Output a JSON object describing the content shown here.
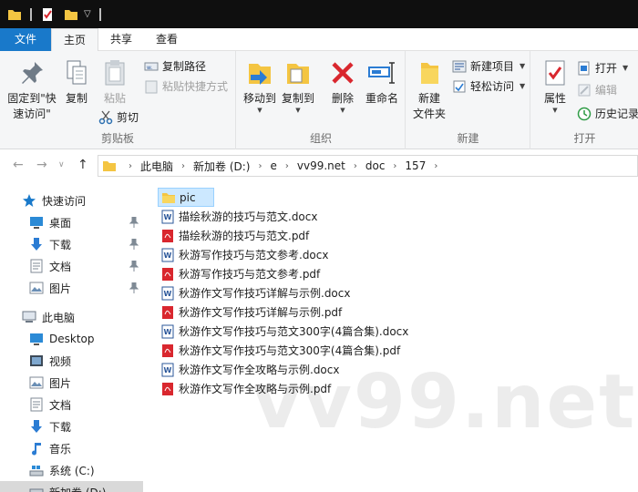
{
  "ribbon_tabs": [
    {
      "label": "文件"
    },
    {
      "label": "主页"
    },
    {
      "label": "共享"
    },
    {
      "label": "查看"
    }
  ],
  "clipboard": {
    "pin_label_1": "固定到\"快",
    "pin_label_2": "速访问\"",
    "copy": "复制",
    "paste": "粘贴",
    "copy_path": "复制路径",
    "paste_shortcut": "粘贴快捷方式",
    "cut": "剪切",
    "group": "剪贴板"
  },
  "organize": {
    "move_to": "移动到",
    "copy_to": "复制到",
    "delete": "删除",
    "rename": "重命名",
    "group": "组织"
  },
  "new_group": {
    "new_folder_1": "新建",
    "new_folder_2": "文件夹",
    "new_item": "新建项目",
    "easy_access": "轻松访问",
    "group": "新建"
  },
  "open_group": {
    "properties": "属性",
    "open": "打开",
    "edit": "编辑",
    "history": "历史记录",
    "group": "打开"
  },
  "address": {
    "crumbs": [
      "此电脑",
      "新加卷 (D:)",
      "e",
      "vv99.net",
      "doc",
      "157"
    ]
  },
  "nav": {
    "quick_access": "快速访问",
    "desktop": "桌面",
    "downloads": "下载",
    "documents": "文档",
    "pictures": "图片",
    "this_pc": "此电脑",
    "pc_desktop": "Desktop",
    "pc_videos": "视频",
    "pc_pictures": "图片",
    "pc_documents": "文档",
    "pc_downloads": "下载",
    "pc_music": "音乐",
    "drive_c": "系统 (C:)",
    "drive_d": "新加卷 (D:)"
  },
  "files": [
    {
      "name": "pic",
      "type": "folder"
    },
    {
      "name": "描绘秋游的技巧与范文.docx",
      "type": "docx"
    },
    {
      "name": "描绘秋游的技巧与范文.pdf",
      "type": "pdf"
    },
    {
      "name": "秋游写作技巧与范文参考.docx",
      "type": "docx"
    },
    {
      "name": "秋游写作技巧与范文参考.pdf",
      "type": "pdf"
    },
    {
      "name": "秋游作文写作技巧详解与示例.docx",
      "type": "docx"
    },
    {
      "name": "秋游作文写作技巧详解与示例.pdf",
      "type": "pdf"
    },
    {
      "name": "秋游作文写作技巧与范文300字(4篇合集).docx",
      "type": "docx"
    },
    {
      "name": "秋游作文写作技巧与范文300字(4篇合集).pdf",
      "type": "pdf"
    },
    {
      "name": "秋游作文写作全攻略与示例.docx",
      "type": "docx"
    },
    {
      "name": "秋游作文写作全攻略与示例.pdf",
      "type": "pdf"
    }
  ],
  "watermark": "vv99.net",
  "icons": {
    "folder": "folder-icon",
    "docx": "word-doc-icon",
    "pdf": "pdf-icon",
    "pin": "pin-icon",
    "star": "star-icon"
  },
  "colors": {
    "file_tab": "#1979ca",
    "folder": "#f4c542",
    "word": "#2b579a",
    "pdf": "#d9272e",
    "selection": "#cce8ff",
    "nav_star": "#1979ca"
  }
}
